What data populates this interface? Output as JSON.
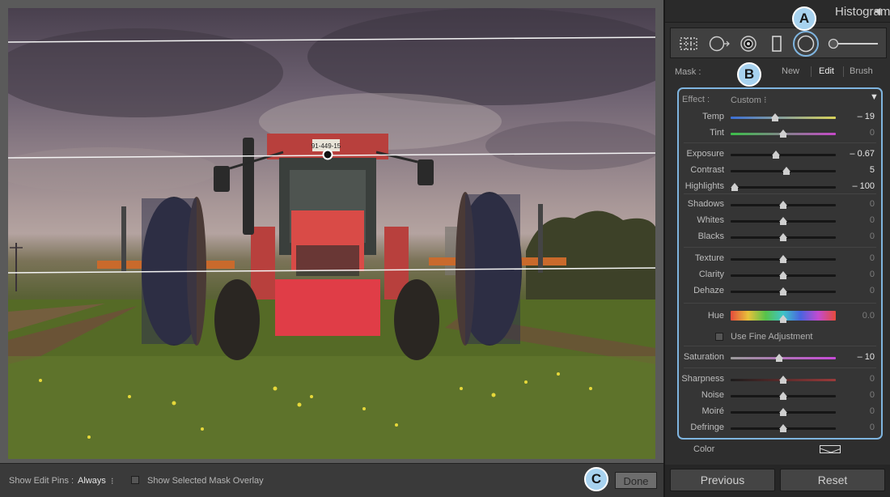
{
  "panel": {
    "histogram_title": "Histogram",
    "collapse_glyph": "◀",
    "mask": {
      "label": "Mask :",
      "options": [
        "New",
        "Edit",
        "Brush"
      ],
      "selected": "Edit"
    },
    "effect": {
      "label": "Effect :",
      "preset": "Custom",
      "preset_glyph": "⁝",
      "toggle_glyph": "▼"
    },
    "sliders": [
      {
        "label": "Temp",
        "value": "– 19",
        "position": 0.42,
        "active": true,
        "track": "temp"
      },
      {
        "label": "Tint",
        "value": "0",
        "position": 0.5,
        "active": false,
        "track": "tint"
      },
      {
        "label": "Exposure",
        "value": "– 0.67",
        "position": 0.43,
        "active": true,
        "track": "plain"
      },
      {
        "label": "Contrast",
        "value": "5",
        "position": 0.53,
        "active": true,
        "track": "plain"
      },
      {
        "label": "Highlights",
        "value": "– 100",
        "position": 0.04,
        "active": true,
        "track": "plain"
      },
      {
        "label": "Shadows",
        "value": "0",
        "position": 0.5,
        "active": false,
        "track": "plain"
      },
      {
        "label": "Whites",
        "value": "0",
        "position": 0.5,
        "active": false,
        "track": "plain"
      },
      {
        "label": "Blacks",
        "value": "0",
        "position": 0.5,
        "active": false,
        "track": "plain"
      },
      {
        "label": "Texture",
        "value": "0",
        "position": 0.5,
        "active": false,
        "track": "plain"
      },
      {
        "label": "Clarity",
        "value": "0",
        "position": 0.5,
        "active": false,
        "track": "plain"
      },
      {
        "label": "Dehaze",
        "value": "0",
        "position": 0.5,
        "active": false,
        "track": "plain"
      },
      {
        "label": "Hue",
        "value": "0.0",
        "position": 0.5,
        "active": false,
        "track": "hue"
      },
      {
        "label": "Saturation",
        "value": "– 10",
        "position": 0.46,
        "active": true,
        "track": "saturation"
      },
      {
        "label": "Sharpness",
        "value": "0",
        "position": 0.5,
        "active": false,
        "track": "sharp"
      },
      {
        "label": "Noise",
        "value": "0",
        "position": 0.5,
        "active": false,
        "track": "plain"
      },
      {
        "label": "Moiré",
        "value": "0",
        "position": 0.5,
        "active": false,
        "track": "plain"
      },
      {
        "label": "Defringe",
        "value": "0",
        "position": 0.5,
        "active": false,
        "track": "plain"
      }
    ],
    "fine_adjustment": {
      "label": "Use Fine Adjustment",
      "checked": false
    },
    "color_label": "Color",
    "buttons": {
      "previous": "Previous",
      "reset": "Reset"
    }
  },
  "toolbar": {
    "edit_pins_label": "Show Edit Pins :",
    "edit_pins_value": "Always",
    "edit_pins_glyph": "⁝",
    "mask_overlay_label": "Show Selected Mask Overlay",
    "done_label": "Done"
  },
  "photo": {
    "plate_text": "91-449-15"
  },
  "callouts": {
    "a": "A",
    "b": "B",
    "c": "C"
  },
  "colors": {
    "accent_outline": "#7fb5e0",
    "callout_fill": "#a7d2ef",
    "tractor_red": "#c9423f"
  }
}
